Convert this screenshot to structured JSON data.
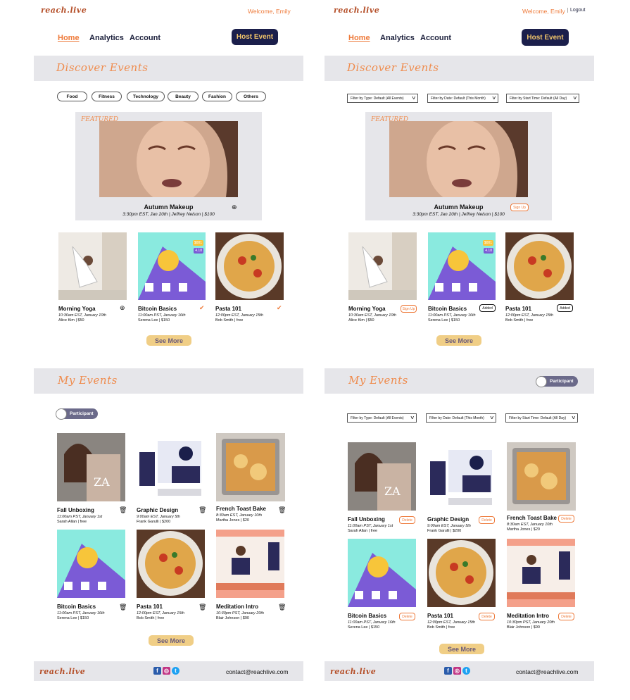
{
  "brand": {
    "logo": "reach.live",
    "footer_logo": "reach.live"
  },
  "header": {
    "welcome": "Welcome, Emily",
    "logout": "Logout"
  },
  "nav": {
    "home": "Home",
    "analytics": "Analytics",
    "account": "Account",
    "host_event": "Host Event"
  },
  "discover": {
    "title": "Discover Events"
  },
  "categories": [
    "Food",
    "Fitness",
    "Technology",
    "Beauty",
    "Fashion",
    "Others"
  ],
  "filters": {
    "type": "Filter by Type:  Default (All Events)",
    "date": "Filter by Date:  Default (This Month)",
    "start": "Filter by Start Time:  Default (All Day)"
  },
  "featured": {
    "label": "FEATURED",
    "title": "Autumn Makeup",
    "meta": "3:30pm EST, Jan 20th | Jeffrey Nelson | $100",
    "signup": "Sign Up"
  },
  "discover_cards": [
    {
      "title": "Morning Yoga",
      "time": "10:30am EST, January 10th",
      "host": "Alice Kim | $50",
      "right_action": "Sign Up"
    },
    {
      "title": "Bitcoin Basics",
      "time": "11:00am PST, January 16th",
      "host": "Serena Lee | $150",
      "right_action": "Added",
      "badge_top": "$001",
      "badge_bottom": "4.18"
    },
    {
      "title": "Pasta 101",
      "time": "12:00pm EST, January 15th",
      "host": "Bob Smith | free",
      "right_action": "Added"
    }
  ],
  "see_more": "See More",
  "my_events": {
    "title": "My Events",
    "toggle": "Participant",
    "delete": "Delete"
  },
  "my_cards": [
    {
      "title": "Fall Unboxing",
      "time": "11:00am PST, January 1st",
      "host": "Sarah Allan | free"
    },
    {
      "title": "Graphic Design",
      "time": "9:00am EST, January 5th",
      "host": "Frank Garulli | $200"
    },
    {
      "title": "French Toast Bake",
      "time": "8:30am EST, January 10th",
      "host": "Martha Jones | $20"
    },
    {
      "title": "Bitcoin Basics",
      "time": "11:00am PST, January 16th",
      "host": "Serena Lee | $150"
    },
    {
      "title": "Pasta 101",
      "time": "12:00pm EST, January 15th",
      "host": "Bob Smith | free"
    },
    {
      "title": "Meditation Intro",
      "time": "10:30pm PST, January 20th",
      "host": "Blair Johnson | $90"
    }
  ],
  "footer": {
    "contact": "contact@reachlive.com"
  },
  "icons": [
    "plus-circle-icon",
    "check-circle-icon",
    "trash-icon",
    "facebook-icon",
    "instagram-icon",
    "twitter-icon"
  ],
  "colors": {
    "accent": "#ee7a3a",
    "navy": "#1b1f4b",
    "gold": "#f1c56a",
    "panel_gray": "#e6e6ea",
    "see_more": "#f0ce86"
  }
}
